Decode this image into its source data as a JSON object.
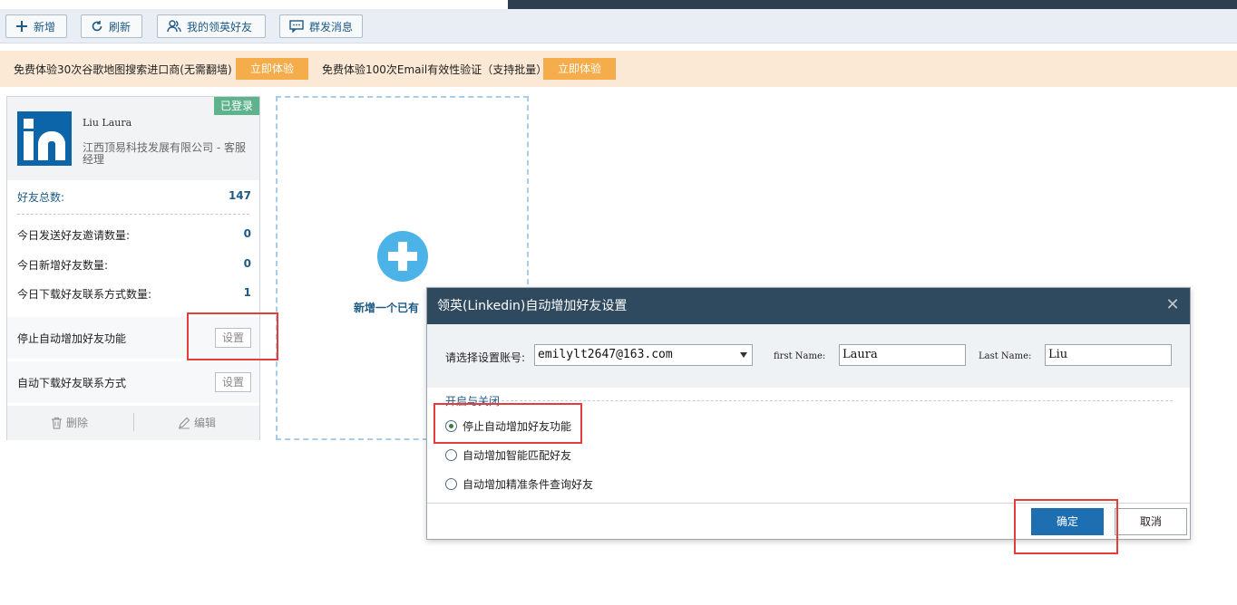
{
  "toolbar": {
    "add": "新增",
    "refresh": "刷新",
    "my_friends": "我的领英好友",
    "broadcast": "群发消息"
  },
  "promo": {
    "text1": "免费体验30次谷歌地图搜索进口商(无需翻墙)",
    "btn1": "立即体验",
    "text2": "免费体验100次Email有效性验证（支持批量）",
    "btn2": "立即体验"
  },
  "account_card": {
    "status_badge": "已登录",
    "name": "Liu Laura",
    "company": "江西顶易科技发展有限公司 - 客服经理",
    "stats": [
      {
        "label": "好友总数:",
        "value": "147"
      },
      {
        "label": "今日发送好友邀请数量:",
        "value": "0"
      },
      {
        "label": "今日新增好友数量:",
        "value": "0"
      },
      {
        "label": "今日下载好友联系方式数量:",
        "value": "1"
      }
    ],
    "func1_label": "停止自动增加好友功能",
    "func1_btn": "设置",
    "func2_label": "自动下载好友联系方式",
    "func2_btn": "设置",
    "delete": "删除",
    "edit": "编辑"
  },
  "add_card": {
    "text": "新增一个已有"
  },
  "dialog": {
    "title": "领英(Linkedin)自动增加好友设置",
    "close": "✕",
    "account_label": "请选择设置账号:",
    "account_value": "emilylt2647@163.com",
    "first_name_label": "first Name:",
    "first_name_value": "Laura",
    "last_name_label": "Last Name:",
    "last_name_value": "Liu",
    "section_title": "开启与关闭",
    "options": [
      {
        "label": "停止自动增加好友功能",
        "selected": true
      },
      {
        "label": "自动增加智能匹配好友",
        "selected": false
      },
      {
        "label": "自动增加精准条件查询好友",
        "selected": false
      }
    ],
    "ok": "确定",
    "cancel": "取消"
  },
  "colors": {
    "accent": "#1d5a85",
    "primary_button": "#1d6fb2",
    "promo_button": "#f5ac4a",
    "badge": "#5fb38c",
    "highlight": "#e63c3c"
  }
}
